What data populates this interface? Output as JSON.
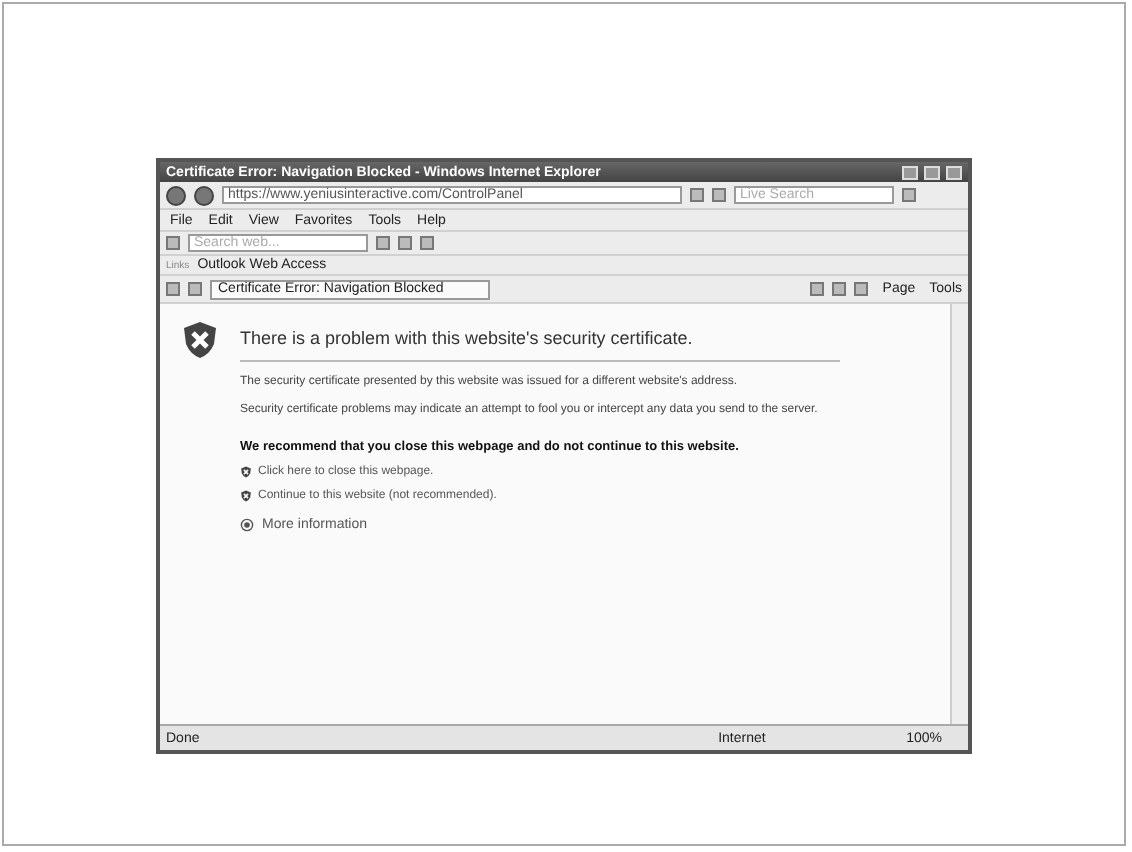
{
  "window": {
    "title": "Certificate Error: Navigation Blocked - Windows Internet Explorer"
  },
  "address": {
    "url": "https://www.yeniusinteractive.com/ControlPanel",
    "search_placeholder": "Live Search"
  },
  "menu": [
    "File",
    "Edit",
    "View",
    "Favorites",
    "Tools",
    "Help"
  ],
  "toolbar": {
    "search_placeholder": "Search web..."
  },
  "links": {
    "label": "Links",
    "items": [
      "Outlook Web Access"
    ]
  },
  "tab": {
    "label": "Certificate Error: Navigation Blocked"
  },
  "commands": [
    "Page",
    "Tools"
  ],
  "page": {
    "heading": "There is a problem with this website's security certificate.",
    "paragraphs": [
      "The security certificate presented by this website was issued for a different website's address.",
      "Security certificate problems may indicate an attempt to fool you or intercept any data you send to the server."
    ],
    "recommendation": "We recommend that you close this webpage and do not continue to this website.",
    "actions": [
      "Click here to close this webpage.",
      "Continue to this website (not recommended)."
    ],
    "more_info": "More information"
  },
  "status": {
    "text": "Done",
    "zone": "Internet",
    "zoom": "100%"
  }
}
